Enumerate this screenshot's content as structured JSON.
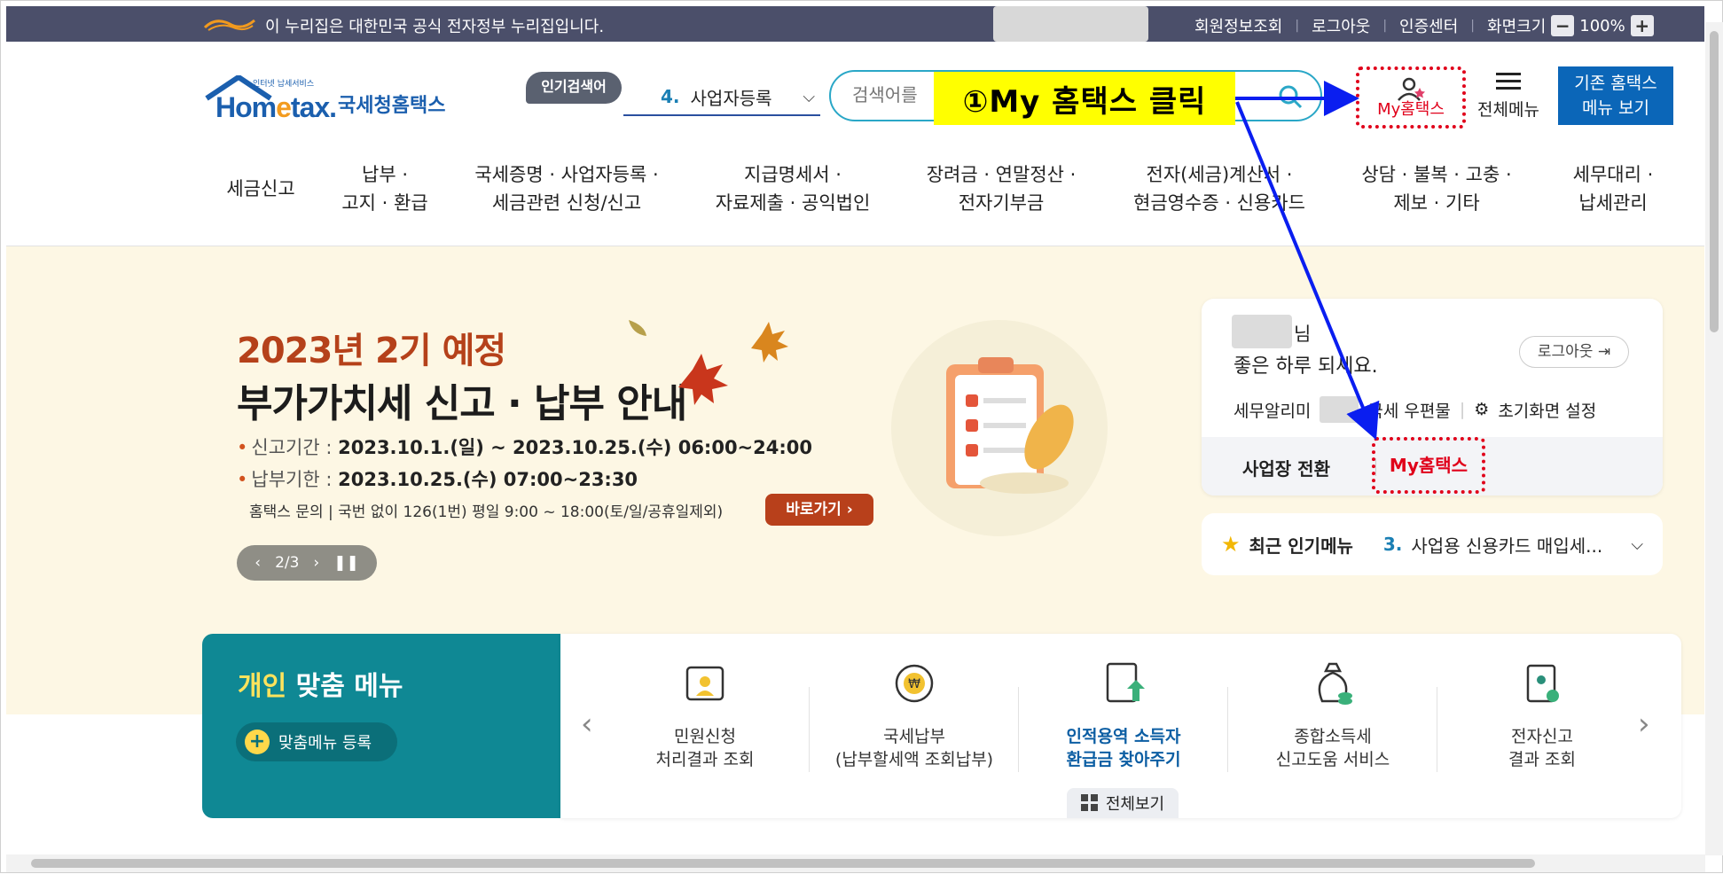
{
  "govbar": {
    "notice": "이 누리집은 대한민국 공식 전자정부 누리집입니다.",
    "links": [
      "회원정보조회",
      "로그아웃",
      "인증센터",
      "화면크기"
    ],
    "zoom_minus": "−",
    "zoom_value": "100%",
    "zoom_plus": "+"
  },
  "brand": {
    "small": "인터넷 납세서비스",
    "word_a": "Hom",
    "word_b": "e",
    "word_c": "tax.",
    "kr": "국세청홈택스"
  },
  "popular": {
    "label": "인기검색어",
    "rank": "4.",
    "item": "사업자등록"
  },
  "search": {
    "placeholder": "검색어를"
  },
  "callout": "①My 홈택스 클릭",
  "header": {
    "myhome": "My홈택스",
    "allmenu": "전체메뉴",
    "legacy_line1": "기존 홈택스",
    "legacy_line2": "메뉴 보기"
  },
  "nav": [
    [
      "세금신고"
    ],
    [
      "납부 ·",
      "고지 · 환급"
    ],
    [
      "국세증명 · 사업자등록 ·",
      "세금관련 신청/신고"
    ],
    [
      "지급명세서 ·",
      "자료제출 · 공익법인"
    ],
    [
      "장려금 · 연말정산 ·",
      "전자기부금"
    ],
    [
      "전자(세금)계산서 ·",
      "현금영수증 · 신용카드"
    ],
    [
      "상담 · 불복 · 고충 ·",
      "제보 · 기타"
    ],
    [
      "세무대리 ·",
      "납세관리"
    ]
  ],
  "banner": {
    "title1": "2023년 2기 예정",
    "title2": "부가가치세 신고 · 납부 안내",
    "line1_label": "신고기간 : ",
    "line1_value": "2023.10.1.(일) ~ 2023.10.25.(수) 06:00~24:00",
    "line2_label": "납부기한 : ",
    "line2_value": "2023.10.25.(수) 07:00~23:30",
    "contact": "홈택스 문의 | 국번 없이 126(1번) 평일 9:00 ~ 18:00(토/일/공휴일제외)",
    "go": "바로가기",
    "pager": "2/3"
  },
  "card": {
    "nim": "님",
    "greeting": "좋은 하루 되세요.",
    "logout": "로그아웃",
    "alarm": "세무알리미",
    "mail": "국세 우편물",
    "settings": "초기화면 설정",
    "switch": "사업장 전환",
    "myhome": "My홈택스"
  },
  "recent": {
    "label": "최근 인기메뉴",
    "rank": "3.",
    "item": "사업용 신용카드 매입세..."
  },
  "personal": {
    "title_a": "개인",
    "title_b": " 맞춤 메뉴",
    "register": "맞춤메뉴 등록",
    "services": [
      [
        "민원신청",
        "처리결과 조회"
      ],
      [
        "국세납부",
        "(납부할세액 조회납부)"
      ],
      [
        "인적용역 소득자",
        "환급금 찾아주기"
      ],
      [
        "종합소득세",
        "신고도움 서비스"
      ],
      [
        "전자신고",
        "결과 조회"
      ]
    ],
    "allview": "전체보기"
  },
  "colors": {
    "govbar": "#4b4f6a",
    "teal": "#0f8894",
    "brand_blue": "#1b5fae",
    "highlight_red": "#e0001a",
    "callout_yellow": "#ffff00",
    "arrow_blue": "#0a1ef0"
  }
}
